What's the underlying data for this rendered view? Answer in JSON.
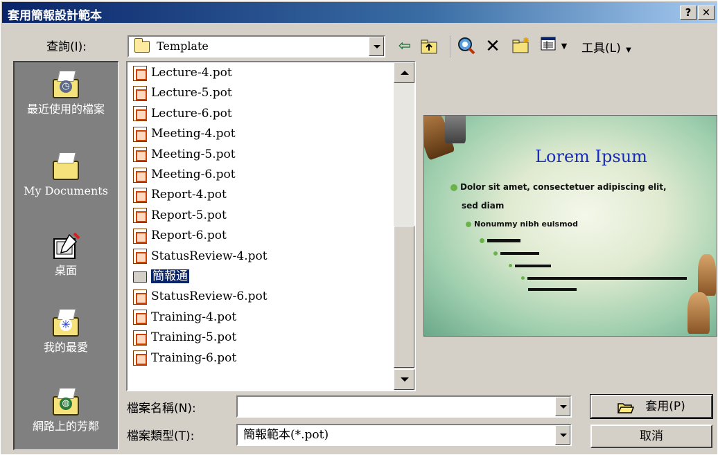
{
  "window": {
    "title": "套用簡報設計範本",
    "help_label": "?",
    "close_label": "✕"
  },
  "lookin": {
    "label": "查詢(I):",
    "value": "Template"
  },
  "toolbar": {
    "back_icon": "back-arrow-icon",
    "up_icon": "up-folder-icon",
    "search_web_icon": "search-web-icon",
    "delete_icon": "delete-icon",
    "new_folder_icon": "new-folder-icon",
    "views_icon": "views-icon",
    "tools_label": "工具(L)"
  },
  "places": [
    {
      "label": "最近使用的檔案",
      "icon": "history-icon"
    },
    {
      "label": "My Documents",
      "icon": "my-documents-icon"
    },
    {
      "label": "桌面",
      "icon": "desktop-icon"
    },
    {
      "label": "我的最愛",
      "icon": "favorites-icon"
    },
    {
      "label": "網路上的芳鄰",
      "icon": "network-icon"
    }
  ],
  "files": [
    {
      "name": "Lecture-4.pot",
      "type": "pot"
    },
    {
      "name": "Lecture-5.pot",
      "type": "pot"
    },
    {
      "name": "Lecture-6.pot",
      "type": "pot"
    },
    {
      "name": "Meeting-4.pot",
      "type": "pot"
    },
    {
      "name": "Meeting-5.pot",
      "type": "pot"
    },
    {
      "name": "Meeting-6.pot",
      "type": "pot"
    },
    {
      "name": "Report-4.pot",
      "type": "pot"
    },
    {
      "name": "Report-5.pot",
      "type": "pot"
    },
    {
      "name": "Report-6.pot",
      "type": "pot"
    },
    {
      "name": "StatusReview-4.pot",
      "type": "pot"
    },
    {
      "name": "簡報通",
      "type": "shortcut",
      "selected": true
    },
    {
      "name": "StatusReview-6.pot",
      "type": "pot"
    },
    {
      "name": "Training-4.pot",
      "type": "pot"
    },
    {
      "name": "Training-5.pot",
      "type": "pot"
    },
    {
      "name": "Training-6.pot",
      "type": "pot"
    }
  ],
  "preview": {
    "title": "Lorem Ipsum",
    "line1": "Dolor sit amet, consectetuer adipiscing elit,",
    "line2": "sed diam",
    "line3": "Nonummy nibh euismod"
  },
  "filename": {
    "label": "檔案名稱(N):",
    "value": ""
  },
  "filetype": {
    "label": "檔案類型(T):",
    "value": "簡報範本(*.pot)"
  },
  "buttons": {
    "apply": "套用(P)",
    "cancel": "取消"
  }
}
